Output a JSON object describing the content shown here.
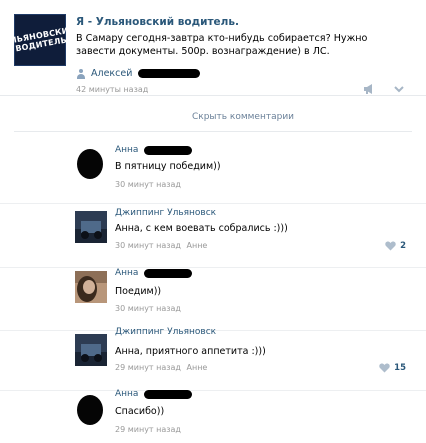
{
  "post": {
    "group_logo_text": "УЛЬЯНОВСКИЙ\nВОДИТЕЛЬ",
    "group_name": "Я - Ульяновский водитель.",
    "text": "В Самару сегодня-завтра кто-нибудь собирается? Нужно завести документы. 500р. вознаграждение) в ЛС.",
    "author": "Алексей",
    "time": "42 минуты назад"
  },
  "hide_comments_label": "Скрыть комментарии",
  "comments": [
    {
      "author": "Анна",
      "text": "В пятницу победим))",
      "time": "30 минут назад",
      "reply_to": "",
      "likes": ""
    },
    {
      "author": "Джиппинг Ульяновск",
      "text": "Анна, с кем воевать собрались :)))",
      "time": "30 минут назад",
      "reply_to": "Анне",
      "likes": "2"
    },
    {
      "author": "Анна",
      "text": "Поедим))",
      "time": "30 минут назад",
      "reply_to": "",
      "likes": ""
    },
    {
      "author": "Джиппинг Ульяновск",
      "text": "Анна, приятного аппетита :)))",
      "time": "29 минут назад",
      "reply_to": "Анне",
      "likes": "15"
    },
    {
      "author": "Анна",
      "text": "Спасибо))",
      "time": "29 минут назад",
      "reply_to": "",
      "likes": ""
    }
  ],
  "colors": {
    "link": "#2b587a",
    "meta": "#999999",
    "accent": "#6b8199"
  },
  "icons": [
    "person-icon",
    "megaphone-icon",
    "chevron-down-icon",
    "heart-icon"
  ]
}
